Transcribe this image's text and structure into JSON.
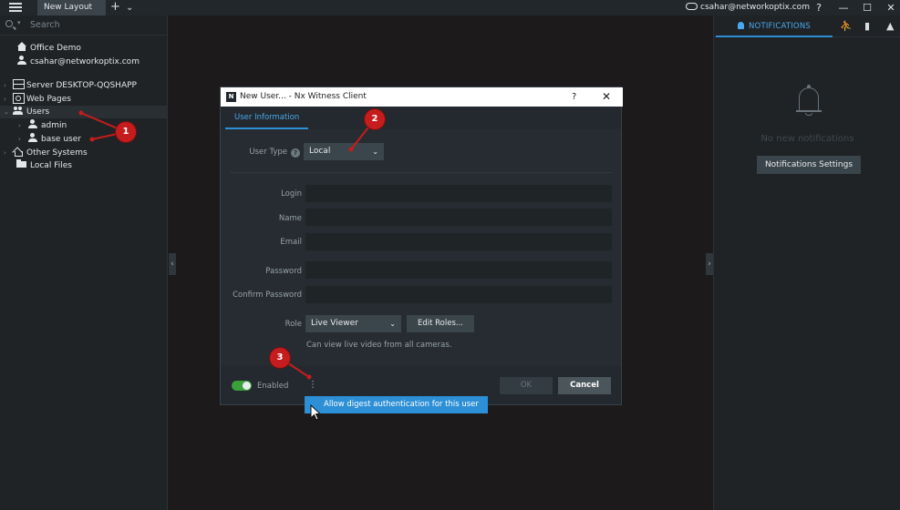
{
  "titlebar": {
    "tab_label": "New Layout",
    "plus": "+",
    "chevron": "⌄",
    "user": "csahar@networkoptix.com",
    "help": "?",
    "minimize": "—",
    "maximize": "☐",
    "close": "✕"
  },
  "sidebar": {
    "search_placeholder": "Search",
    "items": [
      {
        "label": "Office Demo"
      },
      {
        "label": "csahar@networkoptix.com"
      },
      {
        "label": "Server DESKTOP-QQSHAPP"
      },
      {
        "label": "Web Pages"
      },
      {
        "label": "Users"
      },
      {
        "label": "admin"
      },
      {
        "label": "base user"
      },
      {
        "label": "Other Systems"
      },
      {
        "label": "Local Files"
      }
    ]
  },
  "notifications_panel": {
    "tab_label": "NOTIFICATIONS",
    "empty_text": "No new notifications",
    "settings_button": "Notifications Settings"
  },
  "dialog": {
    "title": "New User... - Nx Witness Client",
    "logo": "N",
    "help": "?",
    "close": "✕",
    "tab": "User Information",
    "user_type_label": "User Type",
    "user_type_value": "Local",
    "login_label": "Login",
    "name_label": "Name",
    "email_label": "Email",
    "password_label": "Password",
    "confirm_password_label": "Confirm Password",
    "role_label": "Role",
    "role_value": "Live Viewer",
    "edit_roles_button": "Edit Roles...",
    "role_hint": "Can view live video from all cameras.",
    "enabled_label": "Enabled",
    "ok_button": "OK",
    "cancel_button": "Cancel"
  },
  "popup_menu": {
    "item": "Allow digest authentication for this user"
  },
  "annotations": {
    "badge1": "1",
    "badge2": "2",
    "badge3": "3"
  },
  "colors": {
    "accent": "#2d8fd5",
    "annotation": "#c51d1d",
    "toggle_on": "#3c9f3b"
  }
}
